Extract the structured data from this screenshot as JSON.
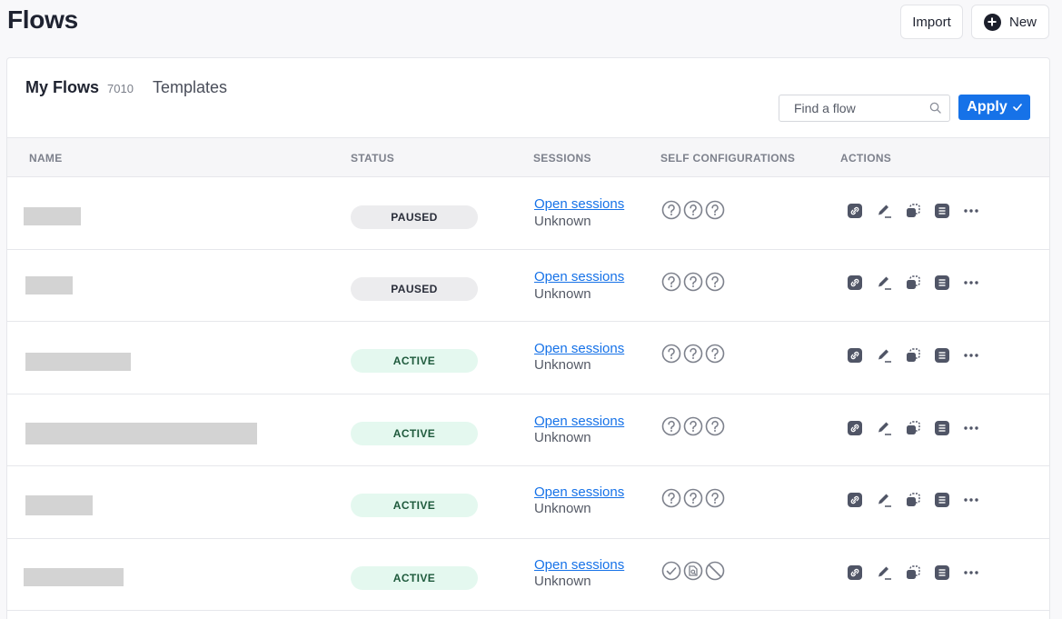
{
  "page": {
    "title": "Flows"
  },
  "header": {
    "import_label": "Import",
    "new_label": "New"
  },
  "tabs": {
    "my_flows_label": "My Flows",
    "my_flows_count": "7010",
    "templates_label": "Templates"
  },
  "search": {
    "placeholder": "Find a flow",
    "value": ""
  },
  "apply": {
    "label": "Apply"
  },
  "columns": {
    "name": "NAME",
    "status": "STATUS",
    "sessions": "SESSIONS",
    "self_config": "SELF CONFIGURATIONS",
    "actions": "ACTIONS"
  },
  "rows": [
    {
      "status": "PAUSED",
      "status_kind": "paused",
      "sessions_link": "Open sessions",
      "sessions_status": "Unknown",
      "config_icons": [
        "question-icon",
        "question-icon",
        "question-icon"
      ]
    },
    {
      "status": "PAUSED",
      "status_kind": "paused",
      "sessions_link": "Open sessions",
      "sessions_status": "Unknown",
      "config_icons": [
        "question-icon",
        "question-icon",
        "question-icon"
      ]
    },
    {
      "status": "ACTIVE",
      "status_kind": "active",
      "sessions_link": "Open sessions",
      "sessions_status": "Unknown",
      "config_icons": [
        "question-icon",
        "question-icon",
        "question-icon"
      ]
    },
    {
      "status": "ACTIVE",
      "status_kind": "active",
      "sessions_link": "Open sessions",
      "sessions_status": "Unknown",
      "config_icons": [
        "question-icon",
        "question-icon",
        "question-icon"
      ]
    },
    {
      "status": "ACTIVE",
      "status_kind": "active",
      "sessions_link": "Open sessions",
      "sessions_status": "Unknown",
      "config_icons": [
        "question-icon",
        "question-icon",
        "question-icon"
      ]
    },
    {
      "status": "ACTIVE",
      "status_kind": "active",
      "sessions_link": "Open sessions",
      "sessions_status": "Unknown",
      "config_icons": [
        "check-circle-icon",
        "document-search-icon",
        "prohibited-icon"
      ]
    }
  ],
  "row_action_icons": [
    "link-icon",
    "edit-icon",
    "duplicate-icon",
    "list-icon",
    "more-icon"
  ],
  "colors": {
    "primary": "#1672e8",
    "active_bg": "#e4f8ef",
    "paused_bg": "#ececee",
    "redacted": "#d3d3d3"
  }
}
